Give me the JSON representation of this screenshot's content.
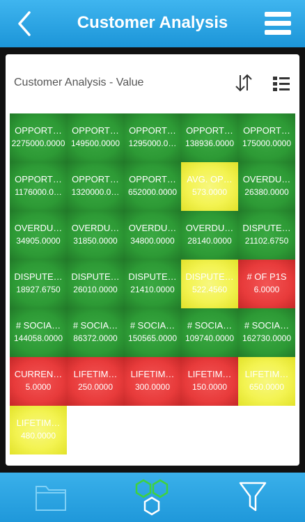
{
  "header": {
    "title": "Customer Analysis"
  },
  "panel": {
    "title": "Customer Analysis - Value"
  },
  "tiles": [
    {
      "label": "OPPORT…",
      "value": "2275000.0000",
      "status": "green"
    },
    {
      "label": "OPPORT…",
      "value": "149500.0000",
      "status": "green"
    },
    {
      "label": "OPPORT…",
      "value": "1295000.0…",
      "status": "green"
    },
    {
      "label": "OPPORT…",
      "value": "138936.0000",
      "status": "green"
    },
    {
      "label": "OPPORT…",
      "value": "175000.0000",
      "status": "green"
    },
    {
      "label": "OPPORT…",
      "value": "1176000.0…",
      "status": "green"
    },
    {
      "label": "OPPORT…",
      "value": "1320000.0…",
      "status": "green"
    },
    {
      "label": "OPPORT…",
      "value": "652000.0000",
      "status": "green"
    },
    {
      "label": "AVG. OP…",
      "value": "573.0000",
      "status": "yellow"
    },
    {
      "label": "OVERDU…",
      "value": "26380.0000",
      "status": "green"
    },
    {
      "label": "OVERDU…",
      "value": "34905.0000",
      "status": "green"
    },
    {
      "label": "OVERDU…",
      "value": "31850.0000",
      "status": "green"
    },
    {
      "label": "OVERDU…",
      "value": "34800.0000",
      "status": "green"
    },
    {
      "label": "OVERDU…",
      "value": "28140.0000",
      "status": "green"
    },
    {
      "label": "DISPUTE…",
      "value": "21102.6750",
      "status": "green"
    },
    {
      "label": "DISPUTE…",
      "value": "18927.6750",
      "status": "green"
    },
    {
      "label": "DISPUTE…",
      "value": "26010.0000",
      "status": "green"
    },
    {
      "label": "DISPUTE…",
      "value": "21410.0000",
      "status": "green"
    },
    {
      "label": "DISPUTE…",
      "value": "522.4560",
      "status": "yellow"
    },
    {
      "label": "# OF P1S",
      "value": "6.0000",
      "status": "red"
    },
    {
      "label": "# SOCIA…",
      "value": "144058.0000",
      "status": "green"
    },
    {
      "label": "# SOCIA…",
      "value": "86372.0000",
      "status": "green"
    },
    {
      "label": "# SOCIA…",
      "value": "150565.0000",
      "status": "green"
    },
    {
      "label": "# SOCIA…",
      "value": "109740.0000",
      "status": "green"
    },
    {
      "label": "# SOCIA…",
      "value": "162730.0000",
      "status": "green"
    },
    {
      "label": "CURREN…",
      "value": "5.0000",
      "status": "red"
    },
    {
      "label": "LIFETIM…",
      "value": "250.0000",
      "status": "red"
    },
    {
      "label": "LIFETIM…",
      "value": "300.0000",
      "status": "red"
    },
    {
      "label": "LIFETIM…",
      "value": "150.0000",
      "status": "red"
    },
    {
      "label": "LIFETIM…",
      "value": "650.0000",
      "status": "yellow"
    },
    {
      "label": "LIFETIM…",
      "value": "480.0000",
      "status": "yellow"
    }
  ],
  "icons": {
    "back": "chevron-left-icon",
    "menu": "hamburger-menu-icon",
    "sort": "sort-arrows-icon",
    "list": "list-view-icon",
    "folder": "folder-icon",
    "hexagons": "hexagons-icon",
    "filter": "filter-icon"
  },
  "colors": {
    "header": "#2aa6e6",
    "green": "#2d9a35",
    "red": "#e83b3b",
    "yellow": "#f3f351"
  }
}
